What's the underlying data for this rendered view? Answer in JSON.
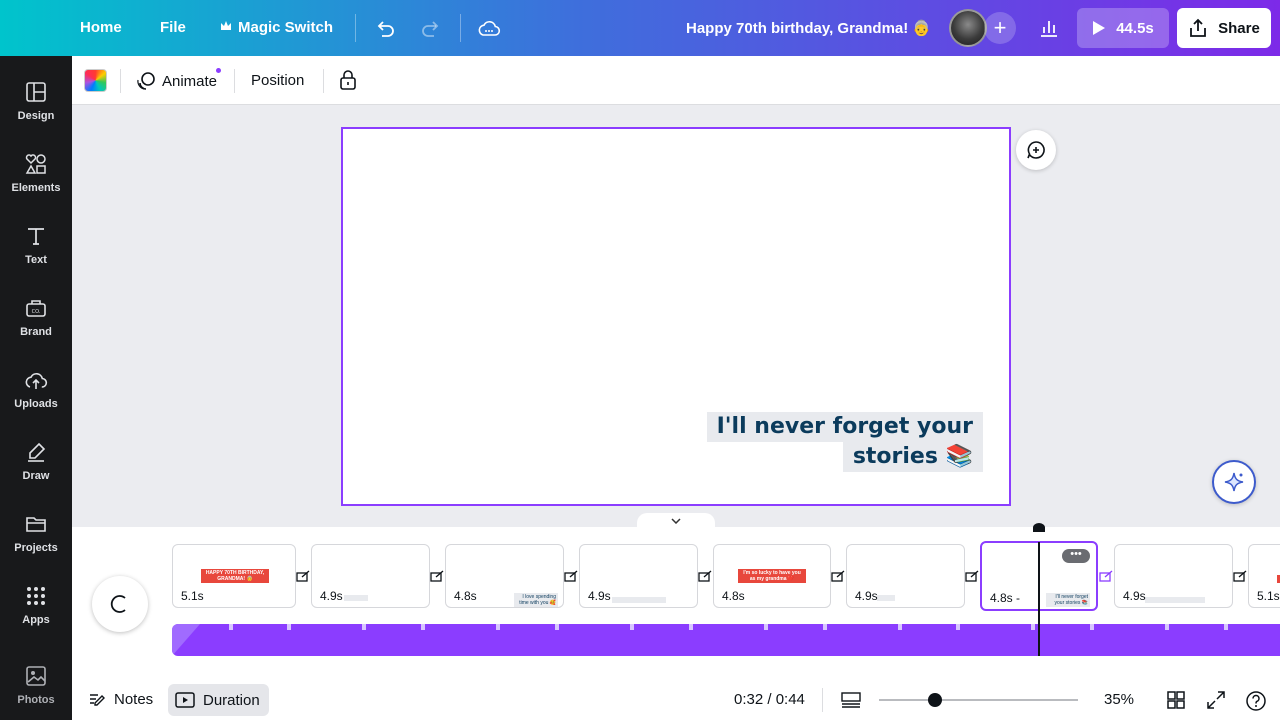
{
  "header": {
    "home": "Home",
    "file": "File",
    "magic_switch": "Magic Switch",
    "doc_title": "Happy 70th birthday, Grandma! 👵",
    "play_time": "44.5s",
    "share": "Share"
  },
  "sidebar": {
    "items": [
      {
        "label": "Design",
        "icon": "design-icon"
      },
      {
        "label": "Elements",
        "icon": "elements-icon"
      },
      {
        "label": "Text",
        "icon": "text-icon"
      },
      {
        "label": "Brand",
        "icon": "brand-icon"
      },
      {
        "label": "Uploads",
        "icon": "uploads-icon"
      },
      {
        "label": "Draw",
        "icon": "draw-icon"
      },
      {
        "label": "Projects",
        "icon": "projects-icon"
      },
      {
        "label": "Apps",
        "icon": "apps-icon"
      },
      {
        "label": "Photos",
        "icon": "photos-icon"
      }
    ]
  },
  "toolbar": {
    "animate": "Animate",
    "position": "Position"
  },
  "canvas": {
    "text_line1": "I'll never forget your",
    "text_line2": "stories 📚"
  },
  "timeline": {
    "pages": [
      {
        "duration": "5.1s",
        "thumb": "HAPPY 70TH BIRTHDAY, GRANDMA! 👵"
      },
      {
        "duration": "4.9s",
        "thumb": ""
      },
      {
        "duration": "4.8s",
        "thumb": "I love spending time with you 🥰"
      },
      {
        "duration": "4.9s",
        "thumb": ""
      },
      {
        "duration": "4.8s",
        "thumb": "I'm so lucky to have you as my grandma ❤️"
      },
      {
        "duration": "4.9s",
        "thumb": ""
      },
      {
        "duration": "4.8s -",
        "thumb": "I'll never forget your stories 📚"
      },
      {
        "duration": "4.9s",
        "thumb": ""
      },
      {
        "duration": "5.1s",
        "thumb": ""
      }
    ],
    "more_label": "•••"
  },
  "footer": {
    "notes": "Notes",
    "duration": "Duration",
    "time": "0:32 / 0:44",
    "zoom": "35%",
    "zoom_level": 0.28
  },
  "colors": {
    "accent": "#8b3dff",
    "sidebar_bg": "#18191b",
    "header_gradient_start": "#00c4cc",
    "header_gradient_end": "#7d2ae8"
  }
}
